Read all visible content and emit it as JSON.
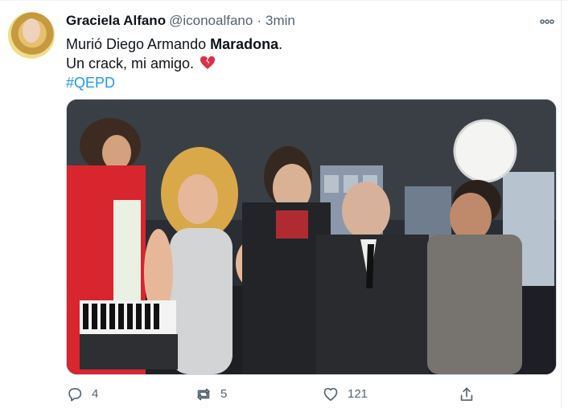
{
  "tweet": {
    "author_name": "Graciela Alfano",
    "handle": "@iconoalfano",
    "separator": "·",
    "time": "3min",
    "lines": [
      {
        "prefix": "Murió Diego Armando ",
        "bold": "Maradona",
        "suffix": "."
      },
      {
        "text": "Un crack, mi amigo."
      },
      {
        "hashtag": "#QEPD"
      }
    ],
    "emoji": "broken-heart-icon",
    "stats": {
      "replies": "4",
      "retweets": "5",
      "likes": "121"
    }
  },
  "colors": {
    "accent": "#1d9bf0",
    "text_primary": "#0f1419",
    "text_secondary": "#536471",
    "heart_red": "#dd2e44"
  },
  "icons": {
    "more": "more-icon",
    "reply": "reply-icon",
    "retweet": "retweet-icon",
    "like": "heart-icon",
    "share": "share-icon"
  }
}
